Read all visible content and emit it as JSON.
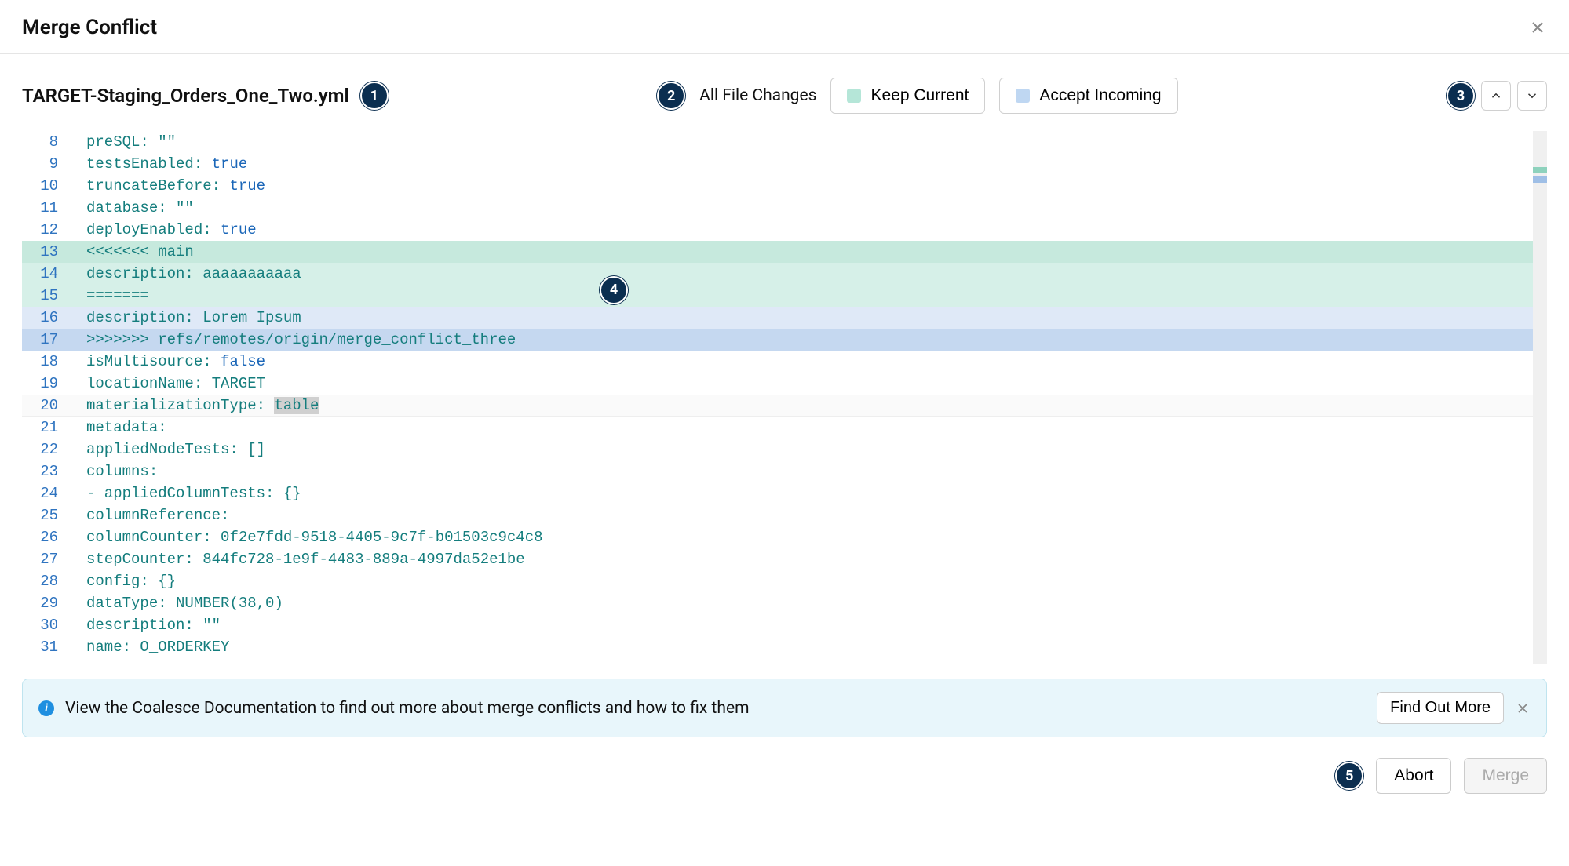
{
  "header": {
    "title": "Merge Conflict"
  },
  "toolbar": {
    "filename": "TARGET-Staging_Orders_One_Two.yml",
    "all_changes_label": "All File Changes",
    "keep_current_label": "Keep Current",
    "accept_incoming_label": "Accept Incoming"
  },
  "badges": {
    "b1": "1",
    "b2": "2",
    "b3": "3",
    "b4": "4",
    "b5": "5"
  },
  "code": {
    "lines": [
      {
        "n": 8,
        "indent": 4,
        "key": "preSQL",
        "value": "\"\""
      },
      {
        "n": 9,
        "indent": 4,
        "key": "testsEnabled",
        "value": "true",
        "bool": true
      },
      {
        "n": 10,
        "indent": 4,
        "key": "truncateBefore",
        "value": "true",
        "bool": true
      },
      {
        "n": 11,
        "indent": 2,
        "key": "database",
        "value": "\"\""
      },
      {
        "n": 12,
        "indent": 2,
        "key": "deployEnabled",
        "value": "true",
        "bool": true
      },
      {
        "n": 13,
        "indent": 0,
        "marker": "<<<<<<< main",
        "hl": "green-dark"
      },
      {
        "n": 14,
        "indent": 2,
        "key": "description",
        "value": "aaaaaaaaaaa",
        "hl": "green"
      },
      {
        "n": 15,
        "indent": 0,
        "marker": "=======",
        "hl": "green"
      },
      {
        "n": 16,
        "indent": 2,
        "key": "description",
        "value": "Lorem Ipsum",
        "hl": "blue"
      },
      {
        "n": 17,
        "indent": 0,
        "marker": ">>>>>>> refs/remotes/origin/merge_conflict_three",
        "hl": "blue-dark"
      },
      {
        "n": 18,
        "indent": 2,
        "key": "isMultisource",
        "value": "false",
        "bool": true
      },
      {
        "n": 19,
        "indent": 2,
        "key": "locationName",
        "value": "TARGET"
      },
      {
        "n": 20,
        "indent": 2,
        "key": "materializationType",
        "value": "table",
        "sel": true,
        "cursor": true
      },
      {
        "n": 21,
        "indent": 2,
        "key": "metadata",
        "value": ""
      },
      {
        "n": 22,
        "indent": 4,
        "key": "appliedNodeTests",
        "value": "[]"
      },
      {
        "n": 23,
        "indent": 4,
        "key": "columns",
        "value": ""
      },
      {
        "n": 24,
        "indent": 6,
        "dash": true,
        "key": "appliedColumnTests",
        "value": "{}"
      },
      {
        "n": 25,
        "indent": 8,
        "key": "columnReference",
        "value": ""
      },
      {
        "n": 26,
        "indent": 10,
        "key": "columnCounter",
        "value": "0f2e7fdd-9518-4405-9c7f-b01503c9c4c8"
      },
      {
        "n": 27,
        "indent": 10,
        "key": "stepCounter",
        "value": "844fc728-1e9f-4483-889a-4997da52e1be"
      },
      {
        "n": 28,
        "indent": 8,
        "key": "config",
        "value": "{}"
      },
      {
        "n": 29,
        "indent": 8,
        "key": "dataType",
        "value": "NUMBER(38,0)"
      },
      {
        "n": 30,
        "indent": 8,
        "key": "description",
        "value": "\"\""
      },
      {
        "n": 31,
        "indent": 8,
        "key": "name",
        "value": "O_ORDERKEY"
      }
    ]
  },
  "banner": {
    "text": "View the Coalesce Documentation to find out more about merge conflicts and how to fix them",
    "find_label": "Find Out More"
  },
  "footer": {
    "abort_label": "Abort",
    "merge_label": "Merge"
  }
}
